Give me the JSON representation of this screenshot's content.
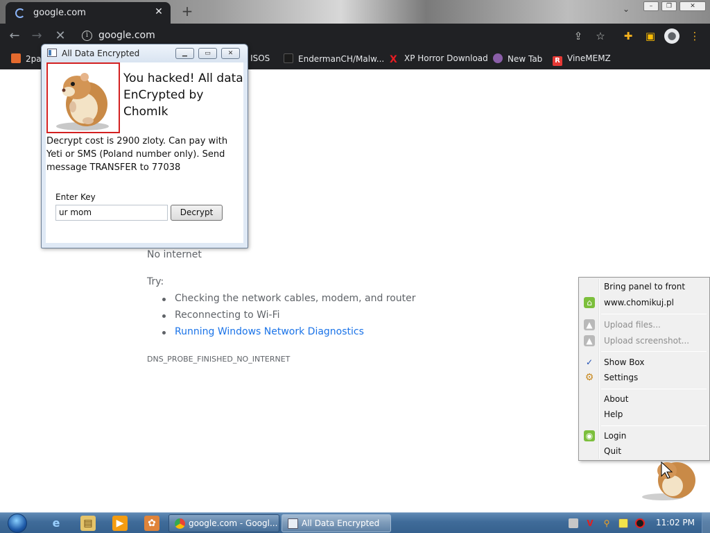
{
  "browser": {
    "tab_title": "google.com",
    "new_tab_symbol": "+",
    "close_tab_symbol": "✕",
    "url": "google.com",
    "bookmarks": [
      {
        "label": "2pa",
        "color": "#e46a2e"
      },
      {
        "label": "s ISOS",
        "color": ""
      },
      {
        "label": "EndermanCH/Malw...",
        "color": "#1b1b1b"
      },
      {
        "label": "XP Horror Download",
        "color": "#e51c23"
      },
      {
        "label": "New Tab",
        "color": "#8a5ea8"
      },
      {
        "label": "VineMEMZ",
        "color": "#e53935"
      }
    ]
  },
  "error_page": {
    "message": "No internet",
    "try_label": "Try:",
    "suggestions": [
      "Checking the network cables, modem, and router",
      "Reconnecting to Wi-Fi",
      "Running Windows Network Diagnostics"
    ],
    "error_code": "DNS_PROBE_FINISHED_NO_INTERNET"
  },
  "dialog": {
    "title": "All Data Encrypted",
    "headline": "You hacked! All data EnCrypted by ChomIk",
    "body": "Decrypt cost is 2900 zloty. Can pay with Yeti or SMS (Poland number only). Send message TRANSFER to 77038",
    "key_label": "Enter Key",
    "key_value": "ur mom",
    "decrypt_label": "Decrypt",
    "frame_color": "#d32020"
  },
  "context_menu": {
    "items": [
      {
        "label": "Bring panel to front",
        "icon": "",
        "enabled": true
      },
      {
        "label": "www.chomikuj.pl",
        "icon": "home-icon",
        "enabled": true
      },
      {
        "label": "Upload files...",
        "icon": "upload-files-icon",
        "enabled": false
      },
      {
        "label": "Upload screenshot...",
        "icon": "upload-screenshot-icon",
        "enabled": false
      },
      {
        "label": "Show Box",
        "icon": "checkmark-icon",
        "enabled": true
      },
      {
        "label": "Settings",
        "icon": "gear-icon",
        "enabled": true
      },
      {
        "label": "About",
        "icon": "",
        "enabled": true
      },
      {
        "label": "Help",
        "icon": "",
        "enabled": true
      },
      {
        "label": "Login",
        "icon": "login-icon",
        "enabled": true
      },
      {
        "label": "Quit",
        "icon": "",
        "enabled": true
      }
    ]
  },
  "taskbar": {
    "buttons": [
      {
        "label": "google.com - Googl...",
        "active": false
      },
      {
        "label": "All Data Encrypted",
        "active": true
      }
    ],
    "clock": "11:02 PM"
  }
}
